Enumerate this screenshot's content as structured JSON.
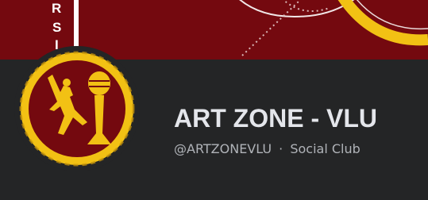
{
  "colors": {
    "cover_background": "#74090f",
    "page_background": "#242526",
    "accent_gold": "#f2c114",
    "name_text": "#e4e6eb",
    "meta_text": "#b0b3b8"
  },
  "cover": {
    "vertical_text": "RSI"
  },
  "profile": {
    "name": "ART ZONE - VLU",
    "handle": "@ARTZONEVLU",
    "separator": "·",
    "category": "Social Club",
    "avatar_icon": "dancer-microphone-logo"
  }
}
